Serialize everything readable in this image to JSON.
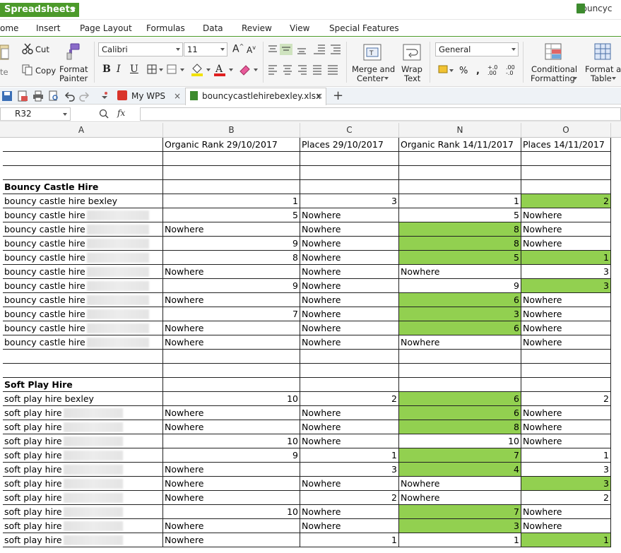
{
  "app": {
    "name": "Spreadsheets",
    "doc_title": "bouncyc"
  },
  "menu": [
    "ome",
    "Insert",
    "Page Layout",
    "Formulas",
    "Data",
    "Review",
    "View",
    "Special Features"
  ],
  "ribbon": {
    "cut": "Cut",
    "copy": "Copy",
    "paste": "te",
    "format_painter_1": "Format",
    "format_painter_2": "Painter",
    "font": "Calibri",
    "font_size": "11",
    "merge_1": "Merge and",
    "merge_2": "Center",
    "wrap_1": "Wrap",
    "wrap_2": "Text",
    "number_format": "General",
    "cond_1": "Conditional",
    "cond_2": "Formatting",
    "fmt_1": "Format as",
    "fmt_2": "Table"
  },
  "tabs": {
    "wps": "My WPS",
    "file": "bouncycastlehirebexley.xlsx *"
  },
  "formula": {
    "namebox": "R32",
    "fx": "fx"
  },
  "columns": [
    "A",
    "B",
    "C",
    "N",
    "O"
  ],
  "headers": [
    "",
    "Organic Rank 29/10/2017",
    "Places 29/10/2017",
    "Organic Rank 14/11/2017",
    "Places 14/11/2017"
  ],
  "sections": [
    {
      "title": "Bouncy Castle Hire",
      "rows": [
        {
          "kw": "bouncy castle hire bexley",
          "blur": false,
          "b": "1",
          "c": "3",
          "n": "1",
          "o": "2",
          "ng": false,
          "og": true
        },
        {
          "kw": "bouncy castle hire",
          "blur": true,
          "b": "5",
          "c": "Nowhere",
          "n": "5",
          "o": "Nowhere",
          "ng": false,
          "og": false
        },
        {
          "kw": "bouncy castle hire",
          "blur": true,
          "b": "Nowhere",
          "c": "Nowhere",
          "n": "8",
          "o": "Nowhere",
          "ng": true,
          "og": false
        },
        {
          "kw": "bouncy castle hire",
          "blur": true,
          "b": "9",
          "c": "Nowhere",
          "n": "8",
          "o": "Nowhere",
          "ng": true,
          "og": false
        },
        {
          "kw": "bouncy castle hire",
          "blur": true,
          "b": "8",
          "c": "Nowhere",
          "n": "5",
          "o": "1",
          "ng": true,
          "og": true
        },
        {
          "kw": "bouncy castle hire",
          "blur": true,
          "b": "Nowhere",
          "c": "Nowhere",
          "n": "Nowhere",
          "o": "3",
          "ng": false,
          "og": false
        },
        {
          "kw": "bouncy castle hire",
          "blur": true,
          "b": "9",
          "c": "Nowhere",
          "n": "9",
          "o": "3",
          "ng": false,
          "og": true
        },
        {
          "kw": "bouncy castle hire",
          "blur": true,
          "b": "Nowhere",
          "c": "Nowhere",
          "n": "6",
          "o": "Nowhere",
          "ng": true,
          "og": false
        },
        {
          "kw": "bouncy castle hire",
          "blur": true,
          "b": "7",
          "c": "Nowhere",
          "n": "3",
          "o": "Nowhere",
          "ng": true,
          "og": false
        },
        {
          "kw": "bouncy castle hire",
          "blur": true,
          "b": "Nowhere",
          "c": "Nowhere",
          "n": "6",
          "o": "Nowhere",
          "ng": true,
          "og": false
        },
        {
          "kw": "bouncy castle hire",
          "blur": true,
          "b": "Nowhere",
          "c": "Nowhere",
          "n": "Nowhere",
          "o": "Nowhere",
          "ng": false,
          "og": false
        }
      ]
    },
    {
      "title": "Soft Play Hire",
      "rows": [
        {
          "kw": "soft play hire bexley",
          "blur": false,
          "b": "10",
          "c": "2",
          "n": "6",
          "o": "2",
          "ng": true,
          "og": false
        },
        {
          "kw": "soft play hire",
          "blur": true,
          "b": "Nowhere",
          "c": "Nowhere",
          "n": "6",
          "o": "Nowhere",
          "ng": true,
          "og": false
        },
        {
          "kw": "soft play hire",
          "blur": true,
          "b": "Nowhere",
          "c": "Nowhere",
          "n": "8",
          "o": "Nowhere",
          "ng": true,
          "og": false
        },
        {
          "kw": "soft play hire",
          "blur": true,
          "b": "10",
          "c": "Nowhere",
          "n": "10",
          "o": "Nowhere",
          "ng": false,
          "og": false
        },
        {
          "kw": "soft play hire",
          "blur": true,
          "b": "9",
          "c": "1",
          "n": "7",
          "o": "1",
          "ng": true,
          "og": false
        },
        {
          "kw": "soft play hire",
          "blur": true,
          "b": "Nowhere",
          "c": "3",
          "n": "4",
          "o": "3",
          "ng": true,
          "og": false
        },
        {
          "kw": "soft play hire",
          "blur": true,
          "b": "Nowhere",
          "c": "Nowhere",
          "n": "Nowhere",
          "o": "3",
          "ng": false,
          "og": true
        },
        {
          "kw": "soft play hire",
          "blur": true,
          "b": "Nowhere",
          "c": "2",
          "n": "Nowhere",
          "o": "2",
          "ng": false,
          "og": false
        },
        {
          "kw": "soft play hire",
          "blur": true,
          "b": "10",
          "c": "Nowhere",
          "n": "7",
          "o": "Nowhere",
          "ng": true,
          "og": false
        },
        {
          "kw": "soft play hire",
          "blur": true,
          "b": "Nowhere",
          "c": "Nowhere",
          "n": "3",
          "o": "Nowhere",
          "ng": true,
          "og": false
        },
        {
          "kw": "soft play hire",
          "blur": true,
          "b": "Nowhere",
          "c": "1",
          "n": "1",
          "o": "1",
          "ng": false,
          "og": true
        }
      ]
    }
  ],
  "colors": {
    "highlight": "#92d050",
    "app_green": "#4c9a2a"
  }
}
